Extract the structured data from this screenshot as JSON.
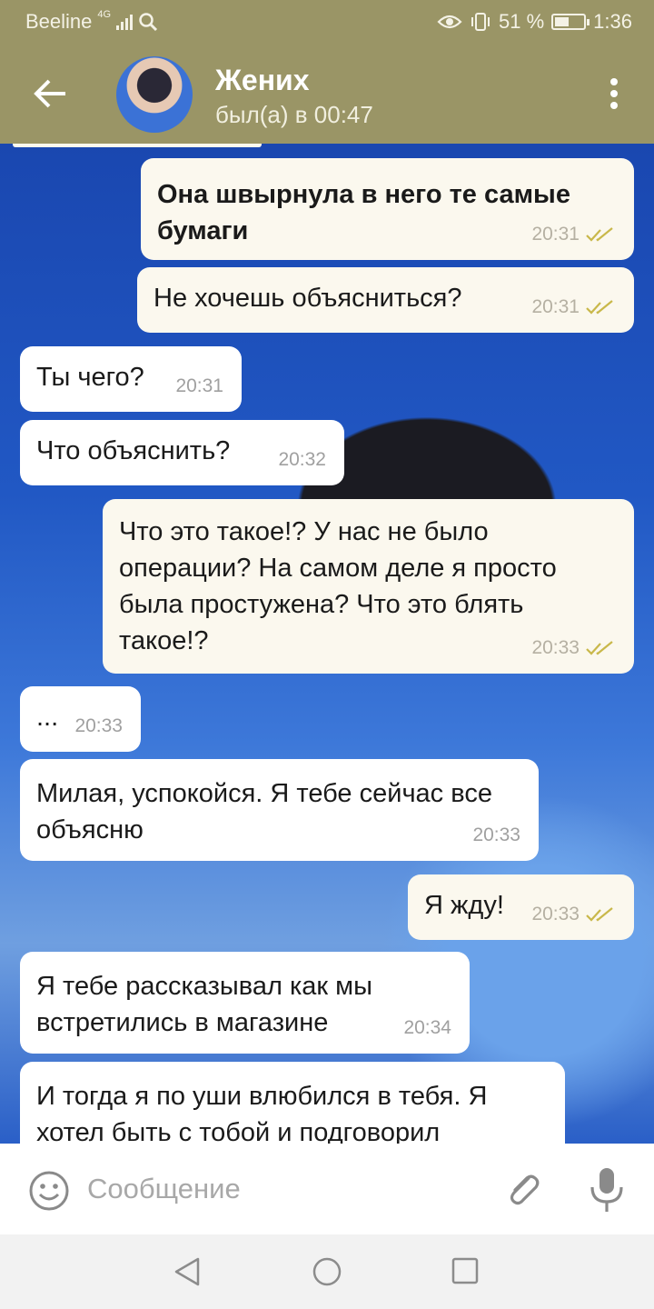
{
  "status_bar": {
    "carrier": "Beeline",
    "network": "4G",
    "battery": "51 %",
    "battery_level": 0.51,
    "time": "1:36"
  },
  "header": {
    "name": "Жених",
    "status": "был(а) в 00:47"
  },
  "messages": [
    {
      "dir": "out",
      "text": "Она швырнула в него те самые бумаги",
      "time": "20:31",
      "bold": true,
      "read": true
    },
    {
      "dir": "out",
      "text": "Не хочешь объясниться?",
      "time": "20:31",
      "read": true
    },
    {
      "dir": "in",
      "text": "Ты чего?",
      "time": "20:31"
    },
    {
      "dir": "in",
      "text": "Что объяснить?",
      "time": "20:32"
    },
    {
      "dir": "out",
      "text": "Что это такое!? У нас не было операции? На самом деле я просто была простужена? Что это блять такое!?",
      "time": "20:33",
      "read": true
    },
    {
      "dir": "in",
      "text": "...",
      "time": "20:33"
    },
    {
      "dir": "in",
      "text": "Милая, успокойся. Я тебе сейчас все объясню",
      "time": "20:33"
    },
    {
      "dir": "out",
      "text": "Я жду!",
      "time": "20:33",
      "read": true
    },
    {
      "dir": "in",
      "text": "Я тебе рассказывал как мы встретились в магазине",
      "time": "20:34"
    },
    {
      "dir": "in",
      "text": "И тогда я по уши влюбился в тебя. Я хотел быть с тобой и подговорил",
      "time": ""
    }
  ],
  "input": {
    "placeholder": "Сообщение"
  },
  "icons": {
    "back": "arrow-left-icon",
    "menu": "more-vertical-icon",
    "emoji": "smiley-icon",
    "attach": "paperclip-icon",
    "mic": "microphone-icon",
    "scroll_down": "chevron-down-icon"
  },
  "colors": {
    "header": "#9a9566",
    "outgoing_bubble": "#fbf8ee",
    "incoming_bubble": "#ffffff",
    "read_check": "#c9b84a"
  }
}
